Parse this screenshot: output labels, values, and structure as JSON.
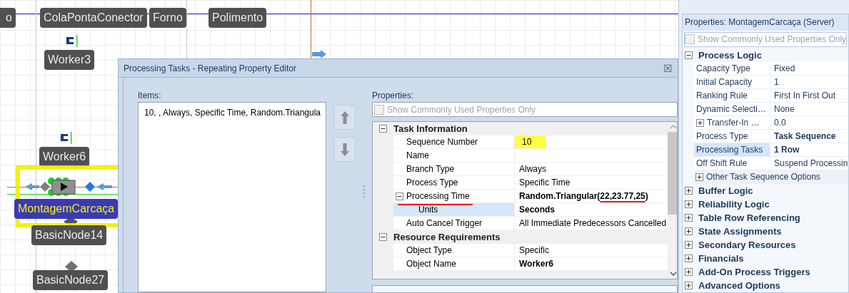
{
  "canvas": {
    "objects": [
      {
        "text": "o",
        "selected": false
      },
      {
        "text": "ColaPontaConector",
        "selected": false
      },
      {
        "text": "Forno",
        "selected": false
      },
      {
        "text": "Polimento",
        "selected": false
      },
      {
        "text": "Worker3",
        "selected": false
      },
      {
        "text": "Worker6",
        "selected": false
      },
      {
        "text": "MontagemCarcaça",
        "selected": true
      },
      {
        "text": "BasicNode14",
        "selected": false
      },
      {
        "text": "BasicNode27",
        "selected": false
      }
    ]
  },
  "dialog": {
    "title": "Processing Tasks - Repeating Property Editor",
    "close": "☒",
    "items_label": "Items:",
    "items": [
      {
        "text": "10, , Always, Specific Time, Random.Triangula",
        "selected": false
      }
    ],
    "properties_label": "Properties:",
    "common_only": {
      "label": "Show Commonly Used Properties Only",
      "checked": false
    },
    "groups": [
      {
        "name": "Task Information",
        "expanded": true,
        "rows": [
          {
            "name": "Sequence Number",
            "value": "10",
            "bold": false,
            "highlighted": true,
            "selected": false
          },
          {
            "name": "Name",
            "selected": false
          },
          {
            "name": "Branch Type",
            "value": "Always",
            "bold": false,
            "highlighted": false,
            "selected": false
          },
          {
            "name": "Process Type",
            "value": "Specific Time",
            "bold": false,
            "highlighted": false,
            "selected": false
          },
          {
            "name": "Processing Time",
            "value_segments": [
              {
                "text": "Random.Triangular(",
                "underlined": false
              },
              {
                "text": "22,23.77,25",
                "underlined": true
              },
              {
                "text": ")",
                "underlined": false
              }
            ],
            "bold": true,
            "highlighted": false,
            "selected": false,
            "underlined": true,
            "expanded": true,
            "children": [
              {
                "name": "Units",
                "value": "Seconds",
                "bold": true,
                "highlighted": false,
                "selected": true
              }
            ]
          },
          {
            "name": "Auto Cancel Trigger",
            "value": "All Immediate Predecessors Cancelled",
            "bold": false,
            "highlighted": false,
            "selected": false
          }
        ]
      },
      {
        "name": "Resource Requirements",
        "expanded": true,
        "rows": [
          {
            "name": "Object Type",
            "value": "Specific",
            "bold": false,
            "highlighted": false,
            "selected": false
          },
          {
            "name": "Object Name",
            "value": "Worker6",
            "bold": true,
            "highlighted": false,
            "selected": false
          }
        ]
      }
    ]
  },
  "properties": {
    "title": "Properties: MontagemCarcaça (Server)",
    "common_only": {
      "label": "Show Commonly Used Properties Only",
      "checked": false
    },
    "groups": [
      {
        "name": "Process Logic",
        "expanded": true,
        "rows": [
          {
            "name": "Capacity Type",
            "value": "Fixed",
            "bold": false,
            "selected": false
          },
          {
            "name": "Initial Capacity",
            "value": "1",
            "bold": false,
            "selected": false
          },
          {
            "name": "Ranking Rule",
            "value": "First In First Out",
            "bold": false,
            "selected": false
          },
          {
            "name": "Dynamic Selecti…",
            "value": "None",
            "bold": false,
            "selected": false
          },
          {
            "name": "Transfer-In …",
            "value": "0.0",
            "bold": false,
            "selected": false,
            "expanded": false
          },
          {
            "name": "Process Type",
            "value": "Task Sequence",
            "bold": true,
            "selected": false
          },
          {
            "name": "Processing Tasks",
            "value": "1 Row",
            "bold": true,
            "selected": true
          },
          {
            "name": "Off Shift Rule",
            "value": "Suspend Processin",
            "bold": false,
            "selected": false
          },
          {
            "name": "Other Task Sequence Options",
            "selected": false,
            "expanded": false,
            "kind": "section"
          }
        ]
      },
      {
        "name": "Buffer Logic",
        "expanded": false
      },
      {
        "name": "Reliability Logic",
        "expanded": false
      },
      {
        "name": "Table Row Referencing",
        "expanded": false
      },
      {
        "name": "State Assignments",
        "expanded": false
      },
      {
        "name": "Secondary Resources",
        "expanded": false
      },
      {
        "name": "Financials",
        "expanded": false
      },
      {
        "name": "Add-On Process Triggers",
        "expanded": false
      },
      {
        "name": "Advanced Options",
        "expanded": false
      }
    ]
  }
}
